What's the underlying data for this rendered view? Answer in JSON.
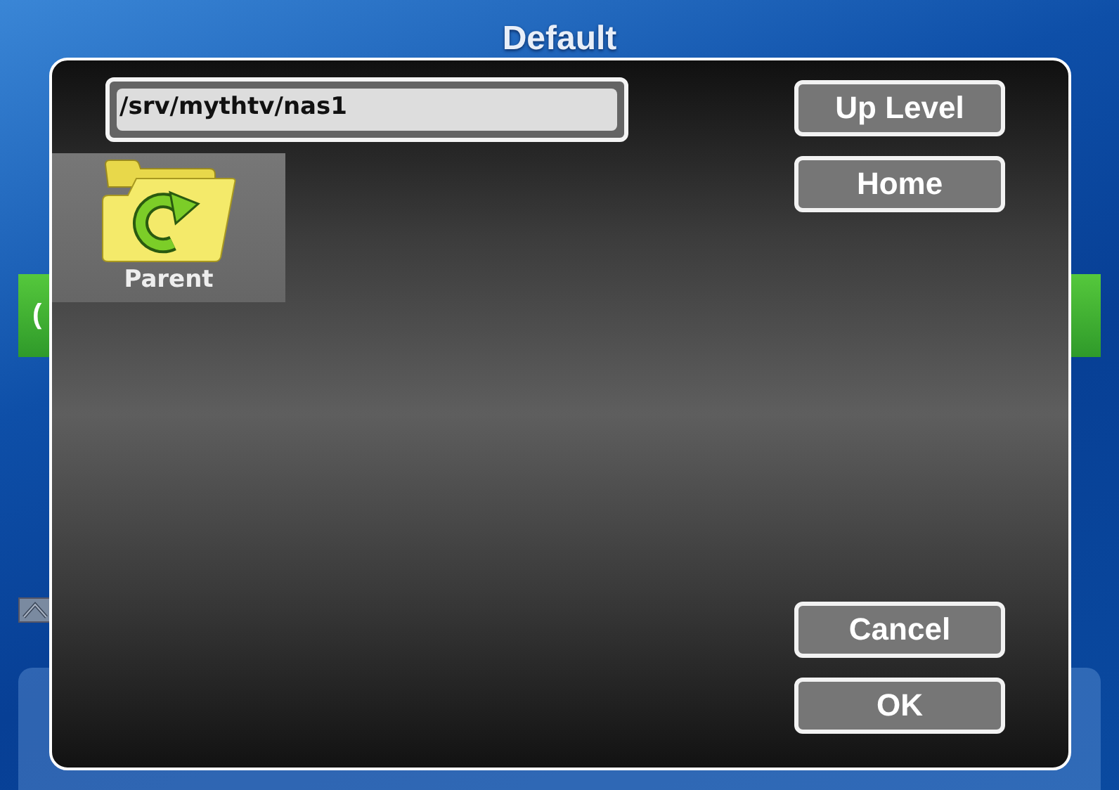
{
  "screen_title": "Default",
  "background": {
    "banner_text": "("
  },
  "dialog": {
    "path": "/srv/mythtv/nas1",
    "items": [
      {
        "label": "Parent",
        "kind": "parent",
        "selected": true
      }
    ],
    "nav_buttons": [
      "Up Level",
      "Home"
    ],
    "action_buttons": [
      "Cancel",
      "OK"
    ]
  }
}
